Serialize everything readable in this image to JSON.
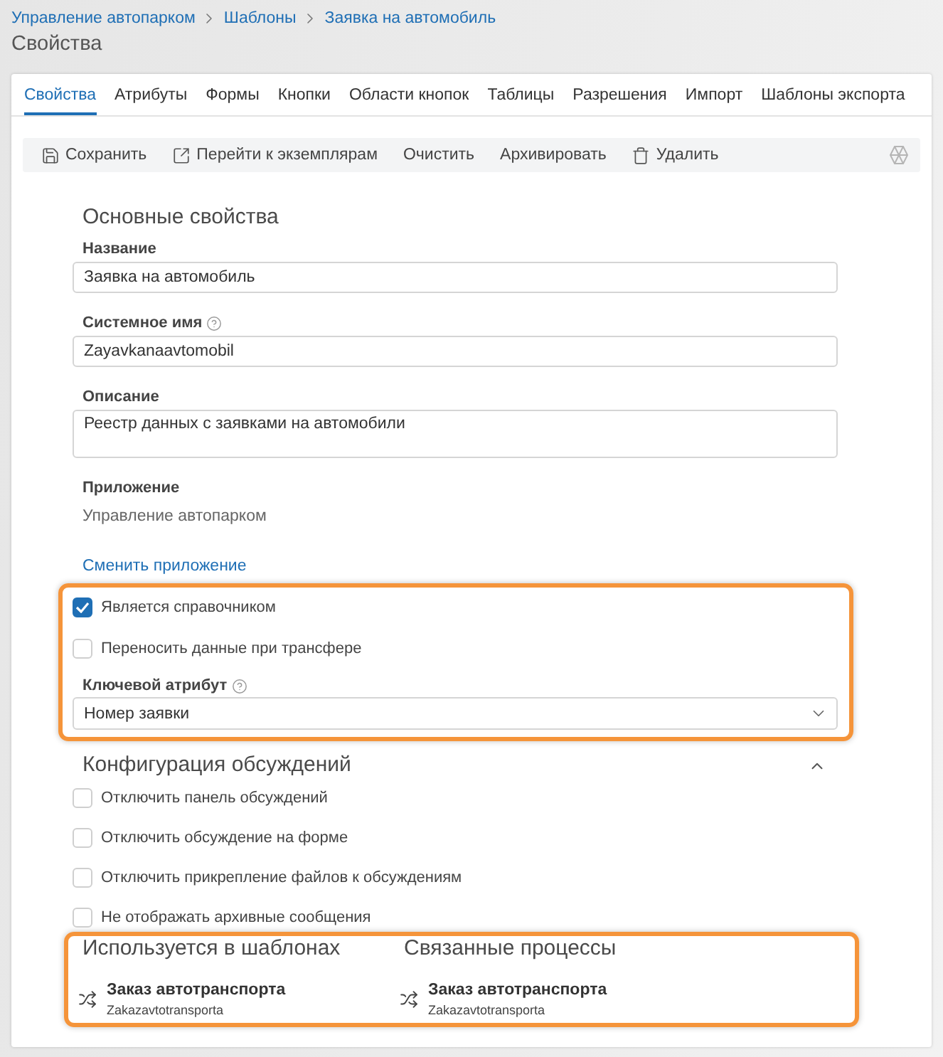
{
  "breadcrumbs": [
    {
      "label": "Управление автопарком"
    },
    {
      "label": "Шаблоны"
    },
    {
      "label": "Заявка на автомобиль"
    }
  ],
  "page_title": "Свойства",
  "tabs": [
    {
      "label": "Свойства",
      "selected": true
    },
    {
      "label": "Атрибуты",
      "selected": false
    },
    {
      "label": "Формы",
      "selected": false
    },
    {
      "label": "Кнопки",
      "selected": false
    },
    {
      "label": "Области кнопок",
      "selected": false
    },
    {
      "label": "Таблицы",
      "selected": false
    },
    {
      "label": "Разрешения",
      "selected": false
    },
    {
      "label": "Импорт",
      "selected": false
    },
    {
      "label": "Шаблоны экспорта",
      "selected": false
    }
  ],
  "toolbar": [
    {
      "label": "Сохранить",
      "kind": "save"
    },
    {
      "label": "Перейти к экземплярам",
      "kind": "navigate"
    },
    {
      "label": "Очистить",
      "kind": "text"
    },
    {
      "label": "Архивировать",
      "kind": "text"
    },
    {
      "label": "Удалить",
      "kind": "delete"
    }
  ],
  "basic_section": {
    "title": "Основные свойства",
    "fields": [
      {
        "label": "Название",
        "value": "Заявка на автомобиль",
        "kind": "input",
        "help": false
      },
      {
        "label": "Системное имя",
        "value": "Zayavkanaavtomobil",
        "kind": "input",
        "help": true
      },
      {
        "label": "Описание",
        "value": "Реестр данных с заявками на автомобили",
        "kind": "textarea",
        "help": false
      }
    ],
    "application": {
      "label": "Приложение",
      "value": "Управление автопарком"
    },
    "change_link": "Сменить приложение"
  },
  "highlighted_options": {
    "checkboxes": [
      {
        "label": "Является справочником",
        "checked": true
      },
      {
        "label": "Переносить данные при трансфере",
        "checked": false
      }
    ],
    "key_attribute": {
      "label": "Ключевой атрибут",
      "help": true,
      "value": "Номер заявки"
    }
  },
  "discussion_section": {
    "title": "Конфигурация обсуждений",
    "expanded": true,
    "checkboxes": [
      {
        "label": "Отключить панель обсуждений",
        "checked": false
      },
      {
        "label": "Отключить обсуждение на форме",
        "checked": false
      },
      {
        "label": "Отключить прикрепление файлов к обсуждениям",
        "checked": false
      },
      {
        "label": "Не отображать архивные сообщения",
        "checked": false
      }
    ]
  },
  "usage": [
    {
      "title": "Используется в шаблонах",
      "items": [
        {
          "name": "Заказ автотранспорта",
          "system_name": "Zakazavtotransporta"
        }
      ]
    },
    {
      "title": "Связанные процессы",
      "items": [
        {
          "name": "Заказ автотранспорта",
          "system_name": "Zakazavtotransporta"
        }
      ]
    }
  ]
}
